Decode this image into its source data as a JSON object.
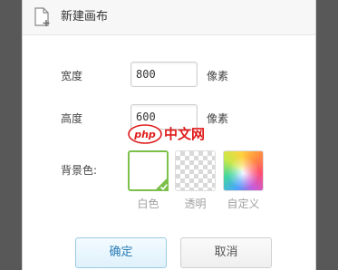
{
  "dialog": {
    "title": "新建画布",
    "icon": "new-file-icon"
  },
  "form": {
    "width_label": "宽度",
    "width_value": "800",
    "width_unit": "像素",
    "height_label": "高度",
    "height_value": "600",
    "height_unit": "像素",
    "background_label": "背景色:"
  },
  "background_options": [
    {
      "label": "白色",
      "selected": true
    },
    {
      "label": "透明",
      "selected": false
    },
    {
      "label": "自定义",
      "selected": false
    }
  ],
  "buttons": {
    "ok": "确定",
    "cancel": "取消"
  },
  "watermark": {
    "logo_text": "php",
    "site_text": "中文网"
  },
  "colors": {
    "selected_border": "#7cc04b",
    "ok_text": "#2b7db6",
    "watermark_red": "#e01a1a"
  }
}
